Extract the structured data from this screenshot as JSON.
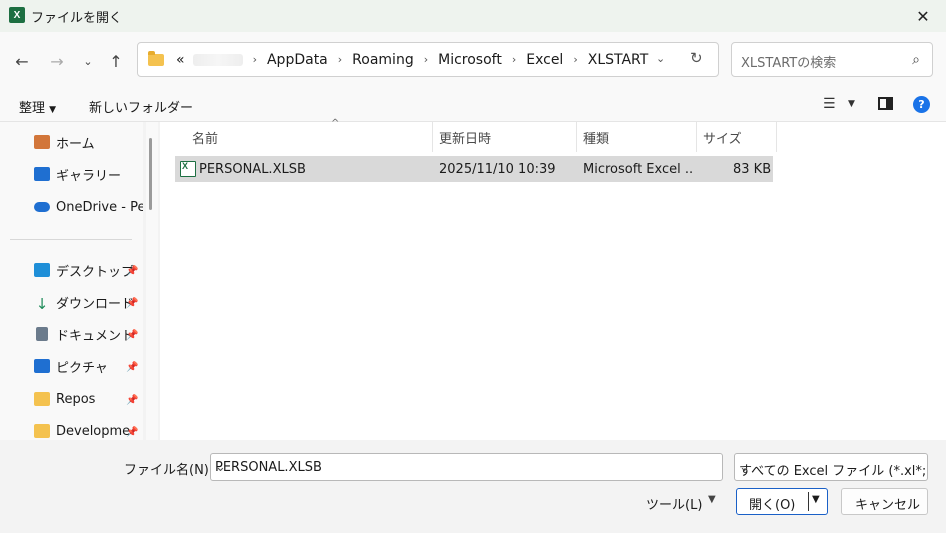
{
  "window": {
    "title": "ファイルを開く",
    "app_icon_letter": "X"
  },
  "navigation": {
    "breadcrumb_overflow": "«",
    "breadcrumbs": [
      "AppData",
      "Roaming",
      "Microsoft",
      "Excel",
      "XLSTART"
    ],
    "search_placeholder": "XLSTARTの検索"
  },
  "toolbar": {
    "organize": "整理",
    "new_folder": "新しいフォルダー"
  },
  "sidebar": {
    "items": [
      {
        "label": "ホーム",
        "icon": "home-icon",
        "color": "#d2763a",
        "pinned": false
      },
      {
        "label": "ギャラリー",
        "icon": "gallery-icon",
        "color": "#1f6fd1",
        "pinned": false
      },
      {
        "label": "OneDrive - Pe",
        "icon": "onedrive-icon",
        "color": "#1f6fd1",
        "pinned": false
      },
      {
        "label": "デスクトップ",
        "icon": "desktop-icon",
        "color": "#1f8fd8",
        "pinned": true
      },
      {
        "label": "ダウンロード",
        "icon": "download-icon",
        "color": "#1e8c5a",
        "pinned": true
      },
      {
        "label": "ドキュメント",
        "icon": "document-icon",
        "color": "#6b7b8c",
        "pinned": true
      },
      {
        "label": "ピクチャ",
        "icon": "pictures-icon",
        "color": "#1f6fd1",
        "pinned": true
      },
      {
        "label": "Repos",
        "icon": "folder-icon",
        "color": "#f4c24f",
        "pinned": true
      },
      {
        "label": "Developme",
        "icon": "folder-icon",
        "color": "#f4c24f",
        "pinned": true
      }
    ]
  },
  "filelist": {
    "columns": [
      "名前",
      "更新日時",
      "種類",
      "サイズ"
    ],
    "rows": [
      {
        "name": "PERSONAL.XLSB",
        "modified": "2025/11/10 10:39",
        "type": "Microsoft Excel ...",
        "size": "83 KB"
      }
    ]
  },
  "bottom": {
    "filename_label": "ファイル名(N):",
    "filename_value": "PERSONAL.XLSB",
    "filetype_value": "すべての Excel ファイル (*.xl*;",
    "tools_label": "ツール(L)",
    "open_label": "開く(O)",
    "cancel_label": "キャンセル"
  }
}
